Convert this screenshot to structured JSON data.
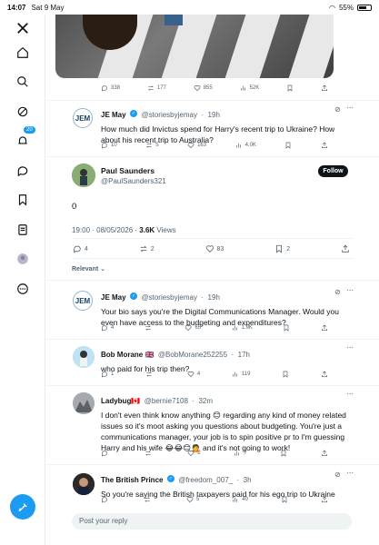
{
  "status_bar": {
    "time": "14:07",
    "date": "Sat 9 May",
    "battery": "55%"
  },
  "rail": {
    "notifications_badge": "20"
  },
  "prev_tweet": {
    "stats": [
      "338",
      "177",
      "855",
      "52K"
    ]
  },
  "reply1": {
    "name": "JE May",
    "handle": "@storiesbyjemay",
    "time": "19h",
    "text": "How much did Invictus spend for Harry's recent trip to Ukraine?  How about his recent trip to Australia?",
    "stats": [
      "10",
      "5",
      "163",
      "4.0K"
    ]
  },
  "main": {
    "name": "Paul Saunders",
    "handle": "@PaulSaunders321",
    "follow_label": "Follow",
    "text": "0",
    "meta_time": "19:00 · 08/05/2026 · ",
    "views": "3.6K",
    "views_label": "Views",
    "stats": [
      "4",
      "2",
      "83",
      "2"
    ]
  },
  "sort": {
    "label": "Relevant"
  },
  "replies": [
    {
      "name": "JE May",
      "handle": "@storiesbyjemay",
      "time": "19h",
      "text": "Your bio says you're the Digital Communications Manager.  Would you even have access to the budgeting and expenditures?",
      "stats": [
        "4",
        "",
        "65",
        "1.9K"
      ]
    },
    {
      "name": "Bob Morane 🇬🇧",
      "handle": "@BobMorane252255",
      "time": "17h",
      "text": "who paid for his trip then?",
      "stats": [
        "1",
        "",
        "4",
        "119"
      ]
    },
    {
      "name": "Ladybug🇨🇦",
      "handle": "@bernie7108",
      "time": "32m",
      "text": "I don't even think know anything 😊 regarding any kind of money related issues so it's moot asking you questions about budgeting. You're just a communications manager, your job is to spin positive pr to I'm guessing Harry and his wife 😂😂😊🙍 and it's not going to work!",
      "stats": [
        "",
        "",
        "2",
        "7"
      ]
    },
    {
      "name": "The British Prince",
      "handle": "@freedom_007_",
      "time": "3h",
      "text": "So you're saying the British taxpayers paid for his ego trip to Ukraine",
      "stats": [
        "",
        "",
        "5",
        "40"
      ]
    }
  ],
  "reply_box": {
    "placeholder": "Post your reply"
  }
}
